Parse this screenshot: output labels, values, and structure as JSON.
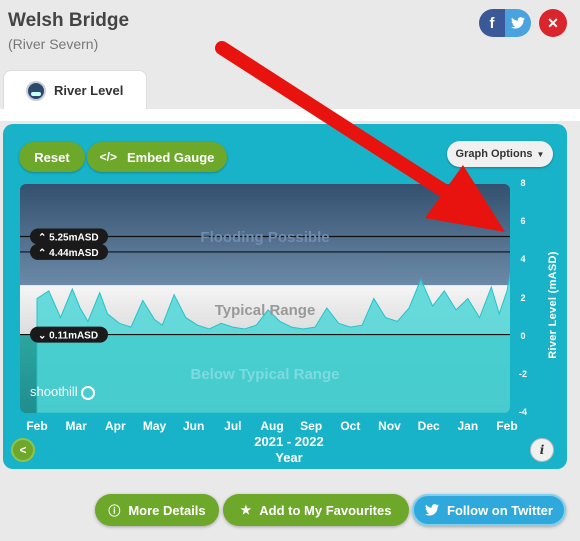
{
  "header": {
    "title": "Welsh Bridge",
    "subtitle": "(River Severn)",
    "share_facebook": "f",
    "close": "✕"
  },
  "tab": {
    "label": "River Level"
  },
  "toolbar": {
    "reset_label": "Reset",
    "embed_label": "Embed Gauge",
    "embed_icon": "</>",
    "graph_options_label": "Graph Options"
  },
  "chart_data": {
    "type": "area",
    "title": "",
    "xlabel": "Year",
    "x_range_label": "2021 - 2022",
    "ylabel": "River Level (mASD)",
    "ylim": [
      -4,
      8
    ],
    "yticks": [
      "8",
      "6",
      "4",
      "2",
      "0",
      "-2",
      "-4"
    ],
    "months": [
      "Feb",
      "Mar",
      "Apr",
      "May",
      "Jun",
      "Jul",
      "Aug",
      "Sep",
      "Oct",
      "Nov",
      "Dec",
      "Jan",
      "Feb"
    ],
    "bands": [
      {
        "name": "Flooding Possible",
        "from": 2.7,
        "to": 8
      },
      {
        "name": "Typical Range",
        "from": 0.11,
        "to": 2.7
      },
      {
        "name": "Below Typical Range",
        "from": -4,
        "to": 0.11
      }
    ],
    "thresholds": [
      {
        "label": "5.25mASD",
        "value": 5.25,
        "dir": "up"
      },
      {
        "label": "4.44mASD",
        "value": 4.44,
        "dir": "up"
      },
      {
        "label": "0.11mASD",
        "value": 0.11,
        "dir": "down"
      }
    ],
    "series": [
      {
        "x": [
          0,
          0.3,
          0.6,
          0.9,
          1.1,
          1.3,
          1.6,
          1.8,
          2.1,
          2.4,
          2.7,
          3.0,
          3.2,
          3.5,
          3.8,
          4.1,
          4.4,
          4.7,
          5.0,
          5.3,
          5.6,
          5.9,
          6.2,
          6.5,
          6.8,
          7.1,
          7.4,
          7.7,
          8.0,
          8.3,
          8.6,
          8.9,
          9.2,
          9.5,
          9.8,
          10.1,
          10.4,
          10.7,
          11.0,
          11.3,
          11.6,
          11.8,
          12.0,
          12.1,
          12.2,
          12.3
        ],
        "y": [
          2.0,
          2.4,
          1.0,
          2.5,
          1.5,
          0.8,
          2.3,
          1.2,
          0.7,
          0.5,
          1.9,
          0.9,
          0.6,
          2.2,
          1.0,
          0.6,
          0.4,
          0.7,
          0.5,
          0.4,
          0.6,
          1.4,
          0.8,
          0.5,
          0.4,
          0.5,
          1.5,
          0.7,
          0.5,
          0.6,
          2.0,
          1.0,
          0.8,
          1.5,
          3.0,
          1.6,
          2.4,
          1.4,
          2.0,
          1.0,
          2.6,
          1.2,
          2.4,
          3.5,
          4.8,
          5.4
        ]
      }
    ]
  },
  "nav": {
    "back": "<",
    "info": "i"
  },
  "footer": {
    "more_details": "More Details",
    "favourites": "Add to My Favourites",
    "twitter": "Follow on Twitter"
  }
}
